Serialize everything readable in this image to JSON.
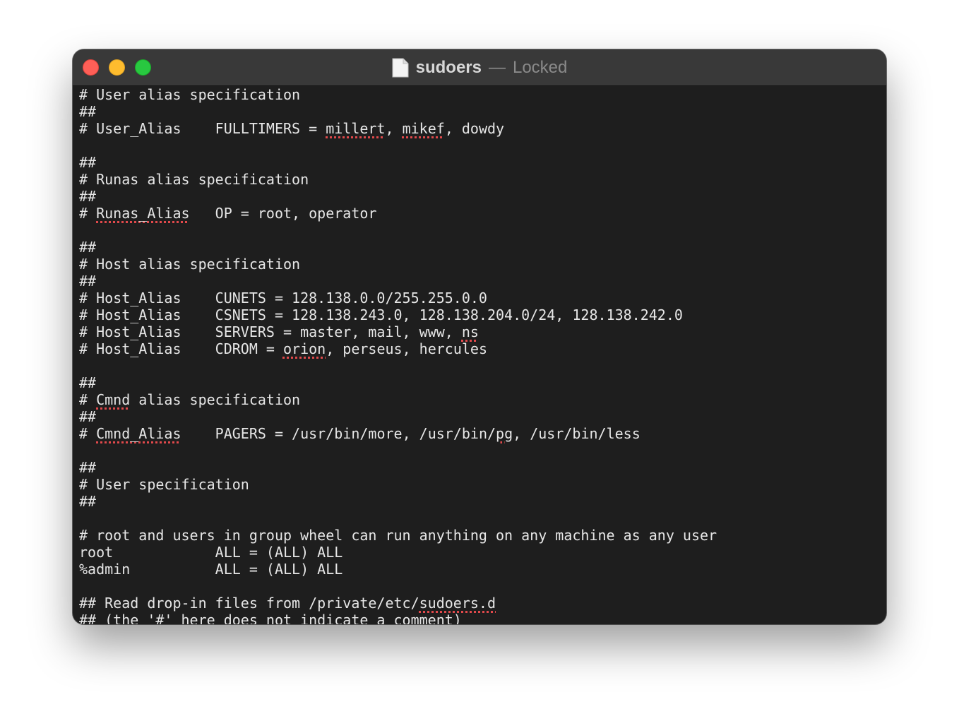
{
  "window": {
    "title": "sudoers",
    "separator": "—",
    "status": "Locked",
    "title_icon": "document-icon",
    "traffic_lights": [
      "close",
      "minimize",
      "zoom"
    ]
  },
  "colors": {
    "background": "#1e1e1e",
    "titlebar": "#393939",
    "text": "#e6e6e6",
    "spellcheck_underline": "#e0494b"
  },
  "lines": [
    [
      "# User alias specification"
    ],
    [
      "##"
    ],
    [
      "# User_Alias    FULLTIMERS = ",
      {
        "t": "millert",
        "flag": true
      },
      ", ",
      {
        "t": "mikef",
        "flag": true
      },
      ", dowdy"
    ],
    [
      ""
    ],
    [
      "##"
    ],
    [
      "# Runas alias specification"
    ],
    [
      "##"
    ],
    [
      "# ",
      {
        "t": "Runas_Alias",
        "flag": true
      },
      "   OP = root, operator"
    ],
    [
      ""
    ],
    [
      "##"
    ],
    [
      "# Host alias specification"
    ],
    [
      "##"
    ],
    [
      "# Host_Alias    CUNETS = 128.138.0.0/255.255.0.0"
    ],
    [
      "# Host_Alias    CSNETS = 128.138.243.0, 128.138.204.0/24, 128.138.242.0"
    ],
    [
      "# Host_Alias    SERVERS = master, mail, www, ",
      {
        "t": "ns",
        "flag": true
      }
    ],
    [
      "# Host_Alias    CDROM = ",
      {
        "t": "orion",
        "flag": true
      },
      ", perseus, hercules"
    ],
    [
      ""
    ],
    [
      "##"
    ],
    [
      "# ",
      {
        "t": "Cmnd",
        "flag": true
      },
      " alias specification"
    ],
    [
      "##"
    ],
    [
      "# ",
      {
        "t": "Cmnd_Alias",
        "flag": true
      },
      "    PAGERS = /usr/bin/more, /usr/bin/",
      {
        "t": "pg",
        "flag": true
      },
      ", /usr/bin/less"
    ],
    [
      ""
    ],
    [
      "##"
    ],
    [
      "# User specification"
    ],
    [
      "##"
    ],
    [
      ""
    ],
    [
      "# root and users in group wheel can run anything on any machine as any user"
    ],
    [
      "root            ALL = (ALL) ALL"
    ],
    [
      "%admin          ALL = (ALL) ALL"
    ],
    [
      ""
    ],
    [
      "## Read drop-in files from /private/etc/",
      {
        "t": "sudoers.d",
        "flag": true
      }
    ],
    [
      "## (the '#' here does not indicate a comment)"
    ]
  ]
}
